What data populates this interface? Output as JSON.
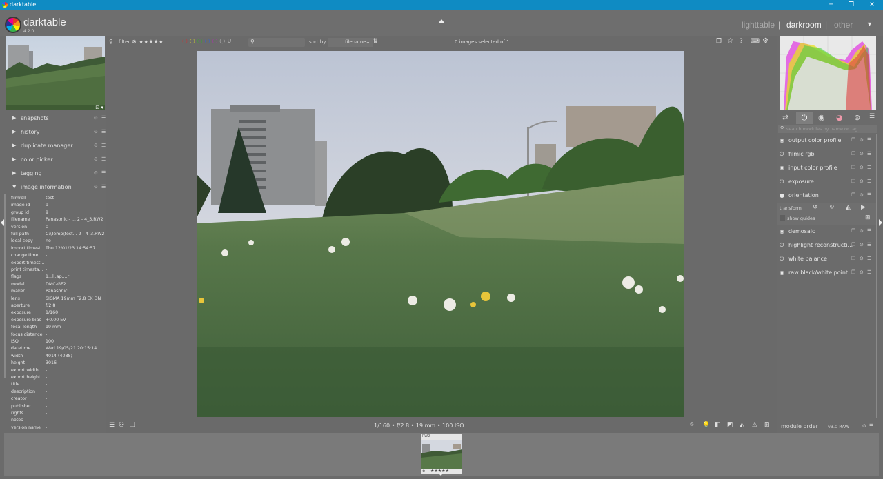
{
  "os": {
    "title": "darktable",
    "minimize": "─",
    "maximize": "❐",
    "close": "✕"
  },
  "app": {
    "name": "darktable",
    "version": "4.2.0"
  },
  "views": {
    "lighttable": "lighttable",
    "darkroom": "darkroom",
    "other": "other",
    "separator": "|",
    "active": "darkroom"
  },
  "toolbar": {
    "filter_label": "filter",
    "stars": "★★★★★",
    "sort_label": "sort by",
    "sort_value": "filename",
    "selection_status": "0 images selected of 1",
    "search_placeholder": ""
  },
  "left_modules": [
    {
      "label": "snapshots",
      "expanded": false
    },
    {
      "label": "history",
      "expanded": false
    },
    {
      "label": "duplicate manager",
      "expanded": false
    },
    {
      "label": "color picker",
      "expanded": false
    },
    {
      "label": "tagging",
      "expanded": false
    },
    {
      "label": "image information",
      "expanded": true
    }
  ],
  "image_info": [
    [
      "filmroll",
      "test"
    ],
    [
      "image id",
      "9"
    ],
    [
      "group id",
      "9"
    ],
    [
      "filename",
      "Panasonic - ... 2 - 4_3.RW2"
    ],
    [
      "version",
      "0"
    ],
    [
      "full path",
      "C:\\Temp\\test... 2 - 4_3.RW2"
    ],
    [
      "local copy",
      "no"
    ],
    [
      "import timest...",
      "Thu 12/01/23 14:54:57"
    ],
    [
      "change time...",
      "-"
    ],
    [
      "export timest...",
      "-"
    ],
    [
      "print timesta...",
      "-"
    ],
    [
      "flags",
      "1...l..ap....r"
    ],
    [
      "model",
      "DMC-GF2"
    ],
    [
      "maker",
      "Panasonic"
    ],
    [
      "lens",
      "SIGMA 19mm F2.8 EX DN"
    ],
    [
      "aperture",
      "f/2.8"
    ],
    [
      "exposure",
      "1/160"
    ],
    [
      "exposure bias",
      "+0.00 EV"
    ],
    [
      "focal length",
      "19 mm"
    ],
    [
      "focus distance",
      "-"
    ],
    [
      "ISO",
      "100"
    ],
    [
      "datetime",
      "Wed 19/05/21 20:15:14"
    ],
    [
      "width",
      "4014 (4088)"
    ],
    [
      "height",
      "3016"
    ],
    [
      "export width",
      "-"
    ],
    [
      "export height",
      "-"
    ],
    [
      "title",
      "-"
    ],
    [
      "description",
      "-"
    ],
    [
      "creator",
      "-"
    ],
    [
      "publisher",
      "-"
    ],
    [
      "rights",
      "-"
    ],
    [
      "notes",
      "-"
    ],
    [
      "version name",
      "-"
    ]
  ],
  "status_line": "1/160 • f/2.8 • 19 mm • 100 ISO",
  "right": {
    "search_placeholder": "search modules by name or tag",
    "modules": [
      {
        "label": "output color profile",
        "power": "◉"
      },
      {
        "label": "filmic rgb",
        "power": "⏻"
      },
      {
        "label": "input color profile",
        "power": "◉"
      },
      {
        "label": "exposure",
        "power": "⏻"
      },
      {
        "label": "orientation",
        "power": "●"
      }
    ],
    "orientation": {
      "transform_label": "transform",
      "show_guides_label": "show guides"
    },
    "modules2": [
      {
        "label": "demosaic",
        "power": "◉"
      },
      {
        "label": "highlight reconstructi...",
        "power": "⏻"
      },
      {
        "label": "white balance",
        "power": "⏻"
      },
      {
        "label": "raw black/white point",
        "power": "◉"
      }
    ],
    "module_order_label": "module order",
    "module_order_value": "v3.0 RAW"
  },
  "filmstrip": {
    "thumb_label": "RW2",
    "stars": "★★★★★"
  },
  "colors": {
    "accent": "#0f8bc3",
    "panel": "#6b6b6b",
    "filmstrip": "#7a7a7a"
  }
}
